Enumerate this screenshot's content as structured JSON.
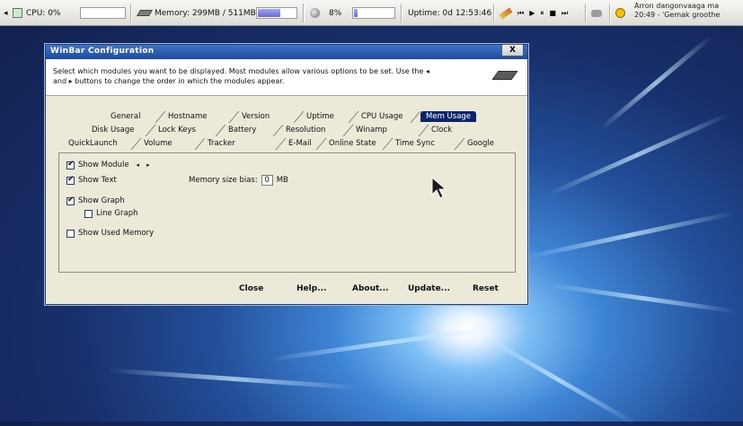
{
  "taskbar": {
    "cpu_label": "CPU: 0%",
    "cpu_usage": 0,
    "memory_label": "Memory: 299MB / 511MB",
    "memory_usage_fraction": 0.585,
    "disk_label": "8%",
    "disk_usage_fraction": 0.08,
    "uptime_label": "Uptime: 0d 12:53:46",
    "tray_text_line1": "Arron dangonvaaga ma",
    "tray_text_line2": "20:49 - 'Gemak groothe"
  },
  "dialog": {
    "title": "WinBar Configuration",
    "close_label": "X",
    "description": "Select which modules you want to be displayed. Most modules allow various options to be set. Use the ◂ and ▸ buttons to change the order in which the modules appear.",
    "tabs_row1": [
      "General",
      "Hostname",
      "Version",
      "Uptime",
      "CPU Usage",
      "Mem Usage"
    ],
    "tabs_row2": [
      "Disk Usage",
      "Lock Keys",
      "Battery",
      "Resolution",
      "Winamp",
      "Clock"
    ],
    "tabs_row3": [
      "QuickLaunch",
      "Volume",
      "Tracker",
      "E-Mail",
      "Online State",
      "Time Sync",
      "Google"
    ],
    "active_tab": "Mem Usage",
    "options": {
      "show_module": "Show Module",
      "show_text": "Show Text",
      "show_graph": "Show Graph",
      "line_graph": "Line Graph",
      "show_used_memory": "Show Used Memory",
      "memory_bias_label": "Memory size bias:",
      "memory_bias_value": "0",
      "memory_bias_unit": "MB"
    },
    "buttons": {
      "close": "Close",
      "help": "Help...",
      "about": "About...",
      "update": "Update...",
      "reset": "Reset"
    }
  }
}
